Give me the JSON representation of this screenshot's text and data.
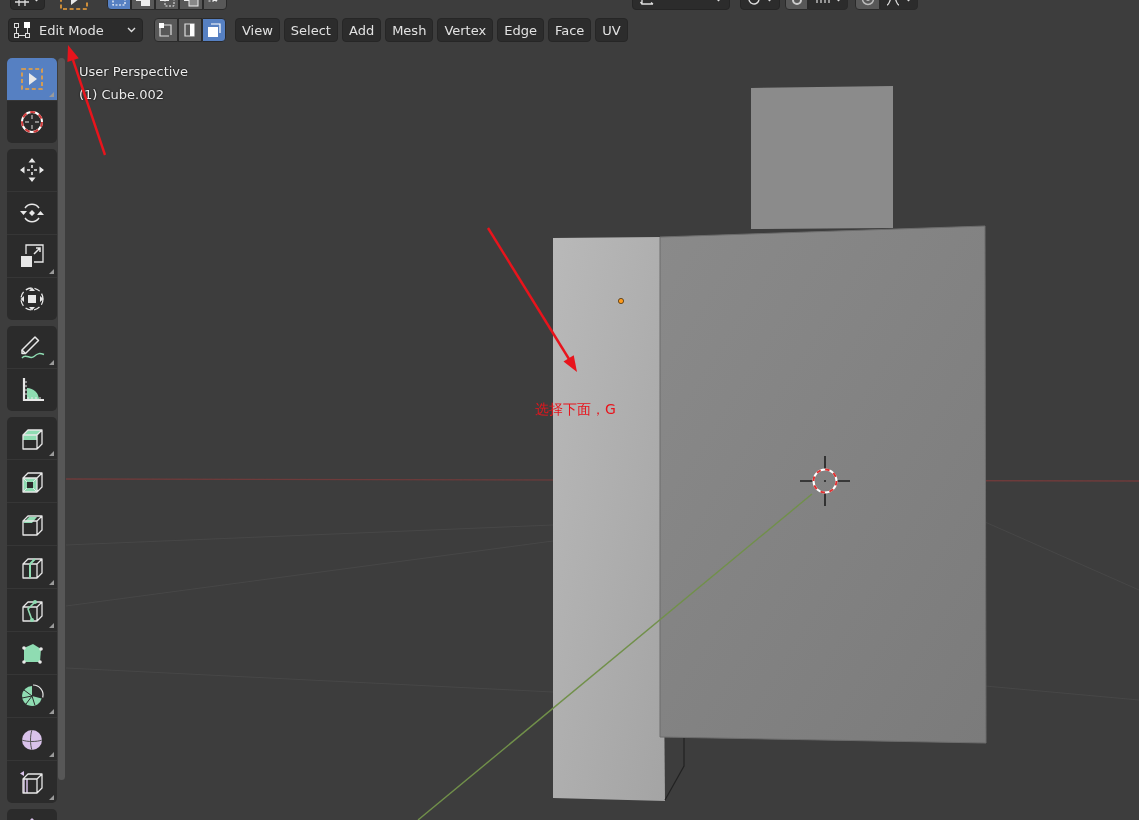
{
  "header_top": {
    "select_modes": [
      {
        "selected": true
      },
      {
        "selected": false
      },
      {
        "selected": false
      },
      {
        "selected": false
      },
      {
        "selected": false
      }
    ]
  },
  "header": {
    "mode": {
      "label": "Edit Mode"
    },
    "select_modes": [
      {
        "selected": false
      },
      {
        "selected": false
      },
      {
        "selected": true
      }
    ],
    "menus": [
      "View",
      "Select",
      "Add",
      "Mesh",
      "Vertex",
      "Edge",
      "Face",
      "UV"
    ]
  },
  "toolbar": {
    "groups": [
      {
        "tools": [
          {
            "kind": "select_box",
            "selected": true,
            "submenu": true
          },
          {
            "kind": "cursor",
            "selected": false,
            "submenu": false
          }
        ]
      },
      {
        "tools": [
          {
            "kind": "move",
            "selected": false,
            "submenu": false
          },
          {
            "kind": "rotate",
            "selected": false,
            "submenu": false
          },
          {
            "kind": "scale",
            "selected": false,
            "submenu": true
          },
          {
            "kind": "transform",
            "selected": false,
            "submenu": false
          }
        ]
      },
      {
        "tools": [
          {
            "kind": "annotate",
            "selected": false,
            "submenu": true
          },
          {
            "kind": "measure",
            "selected": false,
            "submenu": false
          }
        ]
      },
      {
        "tools": [
          {
            "kind": "extrude",
            "selected": false,
            "submenu": true
          },
          {
            "kind": "inset",
            "selected": false,
            "submenu": false
          },
          {
            "kind": "bevel",
            "selected": false,
            "submenu": false
          },
          {
            "kind": "loop_cut",
            "selected": false,
            "submenu": true
          },
          {
            "kind": "knife",
            "selected": false,
            "submenu": true
          },
          {
            "kind": "poly_build",
            "selected": false,
            "submenu": false
          },
          {
            "kind": "spin",
            "selected": false,
            "submenu": true
          },
          {
            "kind": "smooth",
            "selected": false,
            "submenu": true
          },
          {
            "kind": "shrink_fatten",
            "selected": false,
            "submenu": true
          }
        ]
      },
      {
        "tools": [
          {
            "kind": "shear",
            "selected": false,
            "submenu": false
          }
        ]
      }
    ]
  },
  "viewport": {
    "info": [
      "User Perspective",
      "(1) Cube.002"
    ],
    "note": "选择下面，G"
  }
}
